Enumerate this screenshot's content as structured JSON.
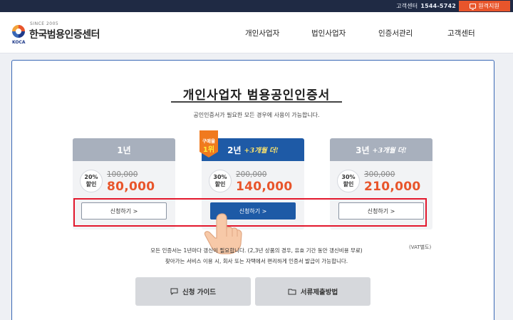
{
  "topbar": {
    "cs_label": "고객센터",
    "cs_phone": "1544-5742",
    "remote_label": "원격지원"
  },
  "logo": {
    "since": "SINCE 2005",
    "name": "한국범용인증센터",
    "abbr": "KOCA"
  },
  "nav": [
    "개인사업자",
    "법인사업자",
    "인증서관리",
    "고객센터"
  ],
  "page": {
    "title": "개인사업자 범용공인인증서",
    "subtitle": "공인인증서가 필요한 모든 경우에 사용이 가능합니다."
  },
  "badge": {
    "line1": "구매율",
    "line2": "1위"
  },
  "plans": [
    {
      "term": "1년",
      "extra": "",
      "discount_pct": "20%",
      "discount_label": "할인",
      "original": "100,000",
      "price": "80,000",
      "button": "신청하기 >"
    },
    {
      "term": "2년",
      "extra": "+3개월 더!",
      "discount_pct": "30%",
      "discount_label": "할인",
      "original": "200,000",
      "price": "140,000",
      "button": "신청하기 >"
    },
    {
      "term": "3년",
      "extra": "+3개월 더!",
      "discount_pct": "30%",
      "discount_label": "할인",
      "original": "300,000",
      "price": "210,000",
      "button": "신청하기 >"
    }
  ],
  "notes": {
    "vat": "(VAT별도)",
    "line1": "모든 인증서는 1년마다 갱신이 필요합니다. (2,3년 상품의 경우, 유효 기간 동안 갱신비용 무료)",
    "line2": "찾아가는 서비스 이용 시, 회사 또는 자택에서 편리하게 인증서 발급이 가능합니다."
  },
  "guides": {
    "apply_guide": "신청 가이드",
    "documents": "서류제출방법"
  },
  "colors": {
    "accent": "#1e5aa6",
    "price": "#e8552b",
    "highlight": "#e3182d",
    "topbar": "#1f2a44"
  }
}
